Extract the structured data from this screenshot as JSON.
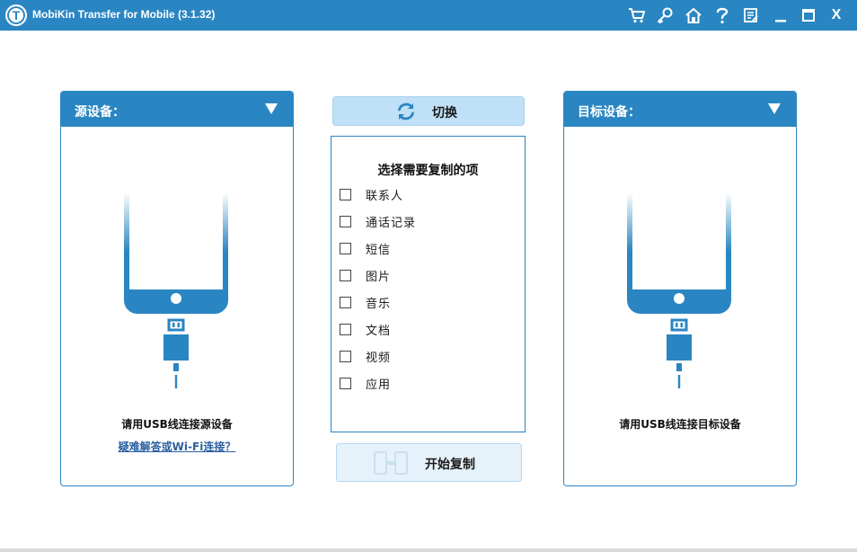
{
  "titlebar": {
    "logo_letter": "T",
    "title": "MobiKin Transfer for Mobile  (3.1.32)",
    "icons": [
      "cart-icon",
      "key-icon",
      "home-icon",
      "help-icon",
      "feedback-icon",
      "minimize-icon",
      "maximize-icon",
      "close-icon"
    ],
    "close_label": "X"
  },
  "source_panel": {
    "title": "源设备：",
    "hint": "请用USB线连接源设备",
    "link": "疑难解答或Wi-Fi连接？"
  },
  "target_panel": {
    "title": "目标设备：",
    "hint": "请用USB线连接目标设备"
  },
  "switch_button": {
    "label": "切换"
  },
  "select": {
    "title": "选择需要复制的项",
    "items": [
      {
        "label": "联系人",
        "checked": false
      },
      {
        "label": "通话记录",
        "checked": false
      },
      {
        "label": "短信",
        "checked": false
      },
      {
        "label": "图片",
        "checked": false
      },
      {
        "label": "音乐",
        "checked": false
      },
      {
        "label": "文档",
        "checked": false
      },
      {
        "label": "视频",
        "checked": false
      },
      {
        "label": "应用",
        "checked": false
      }
    ]
  },
  "start_button": {
    "label": "开始复制"
  },
  "colors": {
    "accent": "#2a86c2",
    "switch_bg": "#bfe0f6",
    "start_bg": "#e6f2fa",
    "link": "#2a5fa0"
  }
}
